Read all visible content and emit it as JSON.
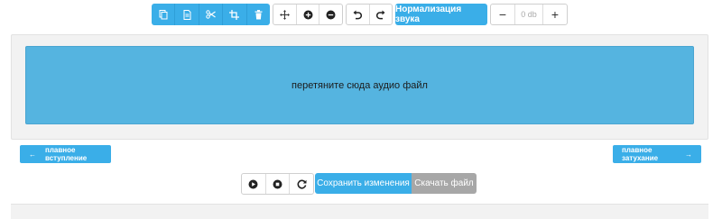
{
  "toolbar": {
    "edit_icons": [
      "copy-icon",
      "paste-icon",
      "cut-icon",
      "crop-icon",
      "trash-icon"
    ],
    "view_icons": [
      "move-icon",
      "zoom-in-icon",
      "zoom-out-icon"
    ],
    "history_icons": [
      "undo-icon",
      "redo-icon"
    ],
    "normalize_label": "Нормализация звука",
    "volume": {
      "minus": "−",
      "value": "0 db",
      "plus": "+"
    }
  },
  "dropzone": {
    "text": "перетяните сюда аудио файл"
  },
  "fade": {
    "in_label": "плавное вступление",
    "in_arrow": "←",
    "out_label": "плавное затухание",
    "out_arrow": "→"
  },
  "playback": {
    "icons": [
      "play-icon",
      "stop-icon",
      "reload-icon"
    ],
    "save_label": "Сохранить изменения",
    "download_label": "Скачать файл"
  },
  "colors": {
    "accent": "#3aaee8",
    "dropzone": "#55b4e0",
    "disabled": "#a7a7a7"
  }
}
